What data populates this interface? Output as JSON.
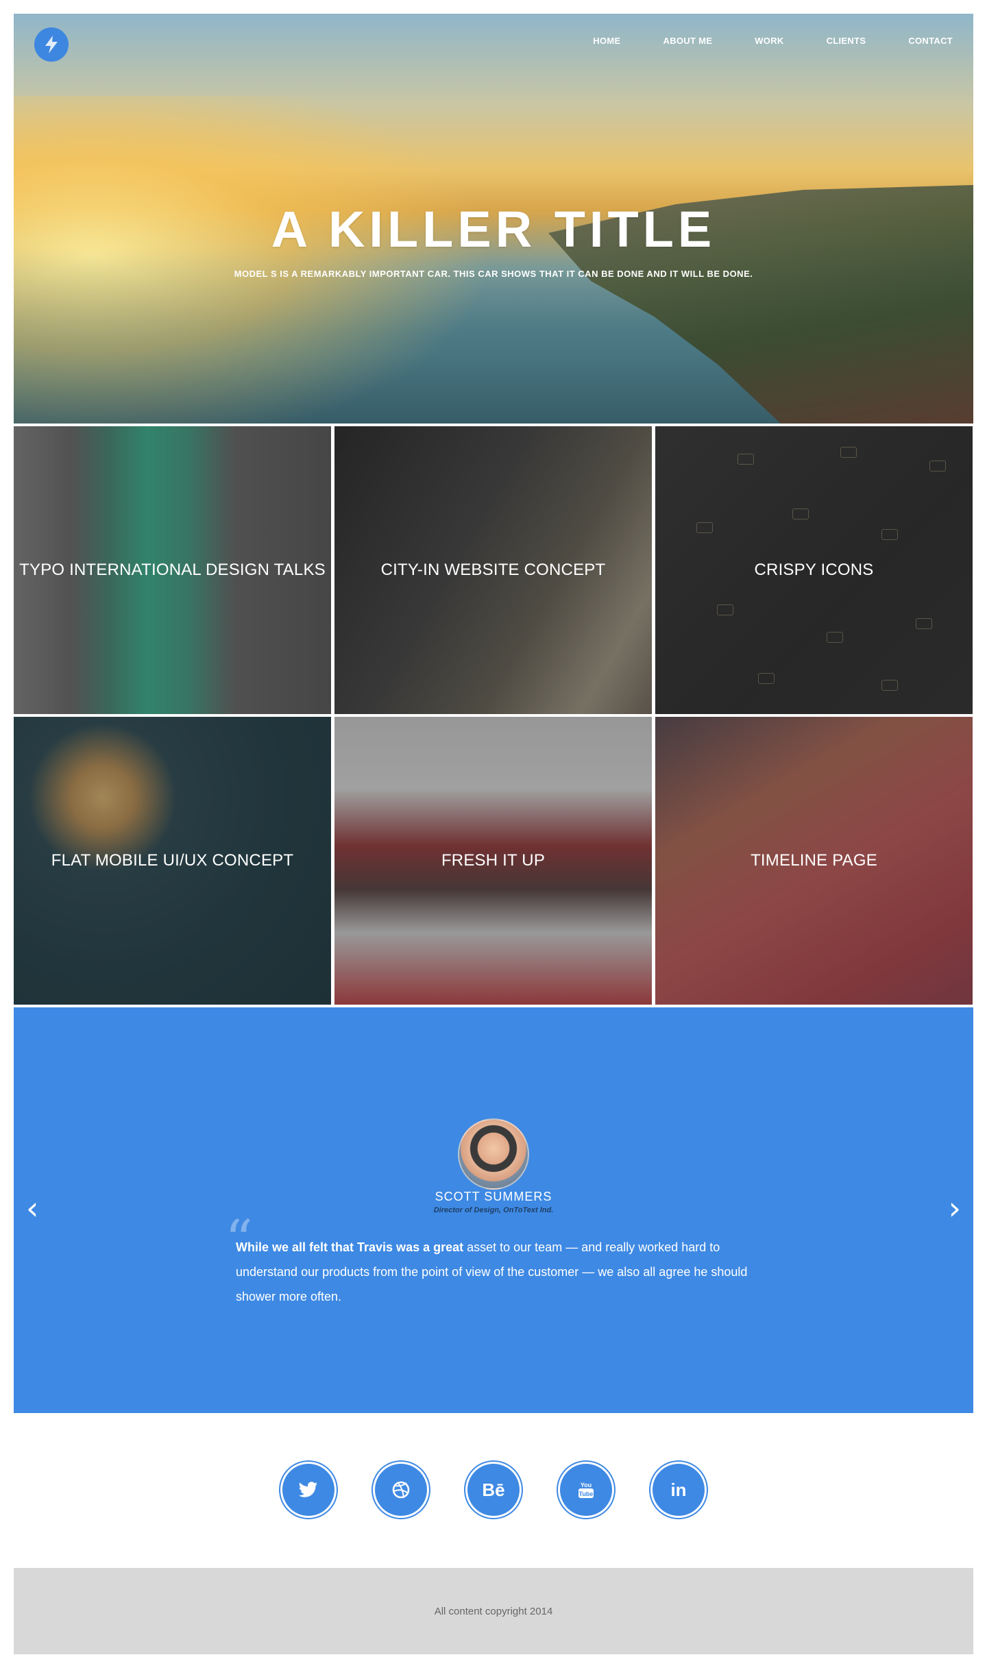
{
  "nav": {
    "items": [
      {
        "label": "HOME"
      },
      {
        "label": "ABOUT ME"
      },
      {
        "label": "WORK"
      },
      {
        "label": "CLIENTS"
      },
      {
        "label": "CONTACT"
      }
    ]
  },
  "hero": {
    "logo_icon": "lightning-bolt-icon",
    "title": "A KILLER TITLE",
    "subtitle": "MODEL S IS A REMARKABLY IMPORTANT CAR. THIS CAR SHOWS THAT IT CAN BE DONE AND IT WILL BE DONE."
  },
  "work": {
    "tiles": [
      {
        "label": "TYPO INTERNATIONAL DESIGN TALKS"
      },
      {
        "label": "CITY-IN WEBSITE CONCEPT"
      },
      {
        "label": "CRISPY ICONS"
      },
      {
        "label": "FLAT MOBILE UI/UX CONCEPT"
      },
      {
        "label": "FRESH IT UP"
      },
      {
        "label": "TIMELINE PAGE"
      }
    ]
  },
  "testimonial": {
    "name": "SCOTT SUMMERS",
    "role": "Director of Design, OnToText Ind.",
    "quote_bold": "While we all felt that Travis was a great",
    "quote_rest": " asset to our team — and really worked hard to understand our products from the point of view of the customer — we also all agree he should shower more often.",
    "prev_icon": "chevron-left-icon",
    "next_icon": "chevron-right-icon",
    "background_color": "#3e89e3"
  },
  "social": [
    {
      "icon": "twitter-icon",
      "glyph": "🐦"
    },
    {
      "icon": "dribbble-icon",
      "glyph": "⊛"
    },
    {
      "icon": "behance-icon",
      "glyph": "Bē"
    },
    {
      "icon": "youtube-icon",
      "glyph": "▶"
    },
    {
      "icon": "linkedin-icon",
      "glyph": "in"
    }
  ],
  "footer": {
    "copyright": "All content copyright 2014"
  },
  "colors": {
    "accent": "#3e89e3",
    "footer_bg": "#d8d8d8"
  }
}
